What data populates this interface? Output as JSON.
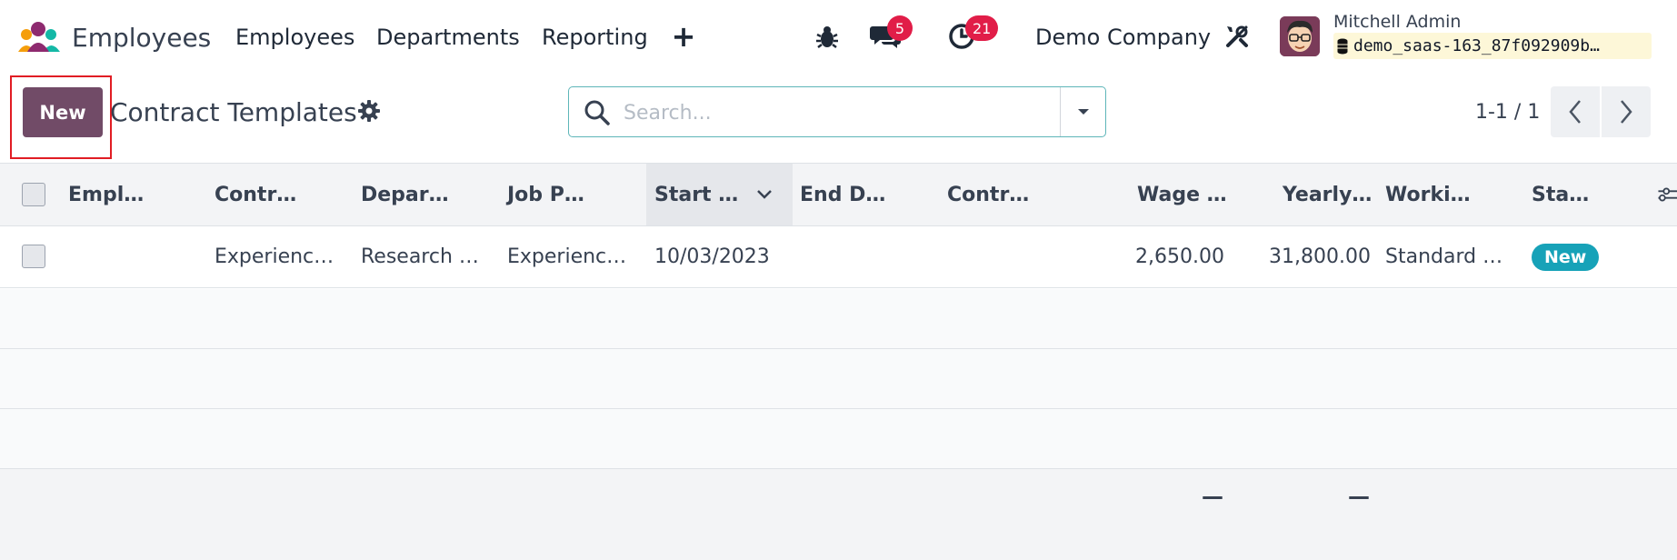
{
  "navbar": {
    "app_name": "Employees",
    "menu": [
      "Employees",
      "Departments",
      "Reporting"
    ],
    "add_icon": "plus-icon",
    "debug_icon": "bug-icon",
    "messages_icon": "chat-icon",
    "messages_count": "5",
    "activities_icon": "clock-icon",
    "activities_count": "21",
    "company": "Demo Company",
    "settings_icon": "tools-icon",
    "user_name": "Mitchell Admin",
    "database": "demo_saas-163_87f092909b…"
  },
  "control_panel": {
    "new_label": "New",
    "title": "Contract Templates",
    "gear_icon": "gear-icon",
    "search_placeholder": "Search...",
    "pager_text": "1-1 / 1"
  },
  "table": {
    "columns": [
      "Empl…",
      "Contr…",
      "Depar…",
      "Job P…",
      "Start …",
      "End D…",
      "Contr…",
      "Wage …",
      "Yearly…",
      "Worki…",
      "Sta…"
    ],
    "sorted_column": "Start …",
    "rows": [
      {
        "employee": "",
        "contract": "Experienc…",
        "department": "Research …",
        "job_position": "Experienc…",
        "start_date": "10/03/2023",
        "end_date": "",
        "contract_type": "",
        "wage": "2,650.00",
        "yearly": "31,800.00",
        "working": "Standard …",
        "status": "New"
      }
    ],
    "footer": {
      "wage_sum": "—",
      "yearly_sum": "—"
    }
  },
  "colors": {
    "brand": "#714b67",
    "badge": "#e11d48",
    "status_new": "#17a2b8",
    "highlight_box": "#e11d24"
  }
}
